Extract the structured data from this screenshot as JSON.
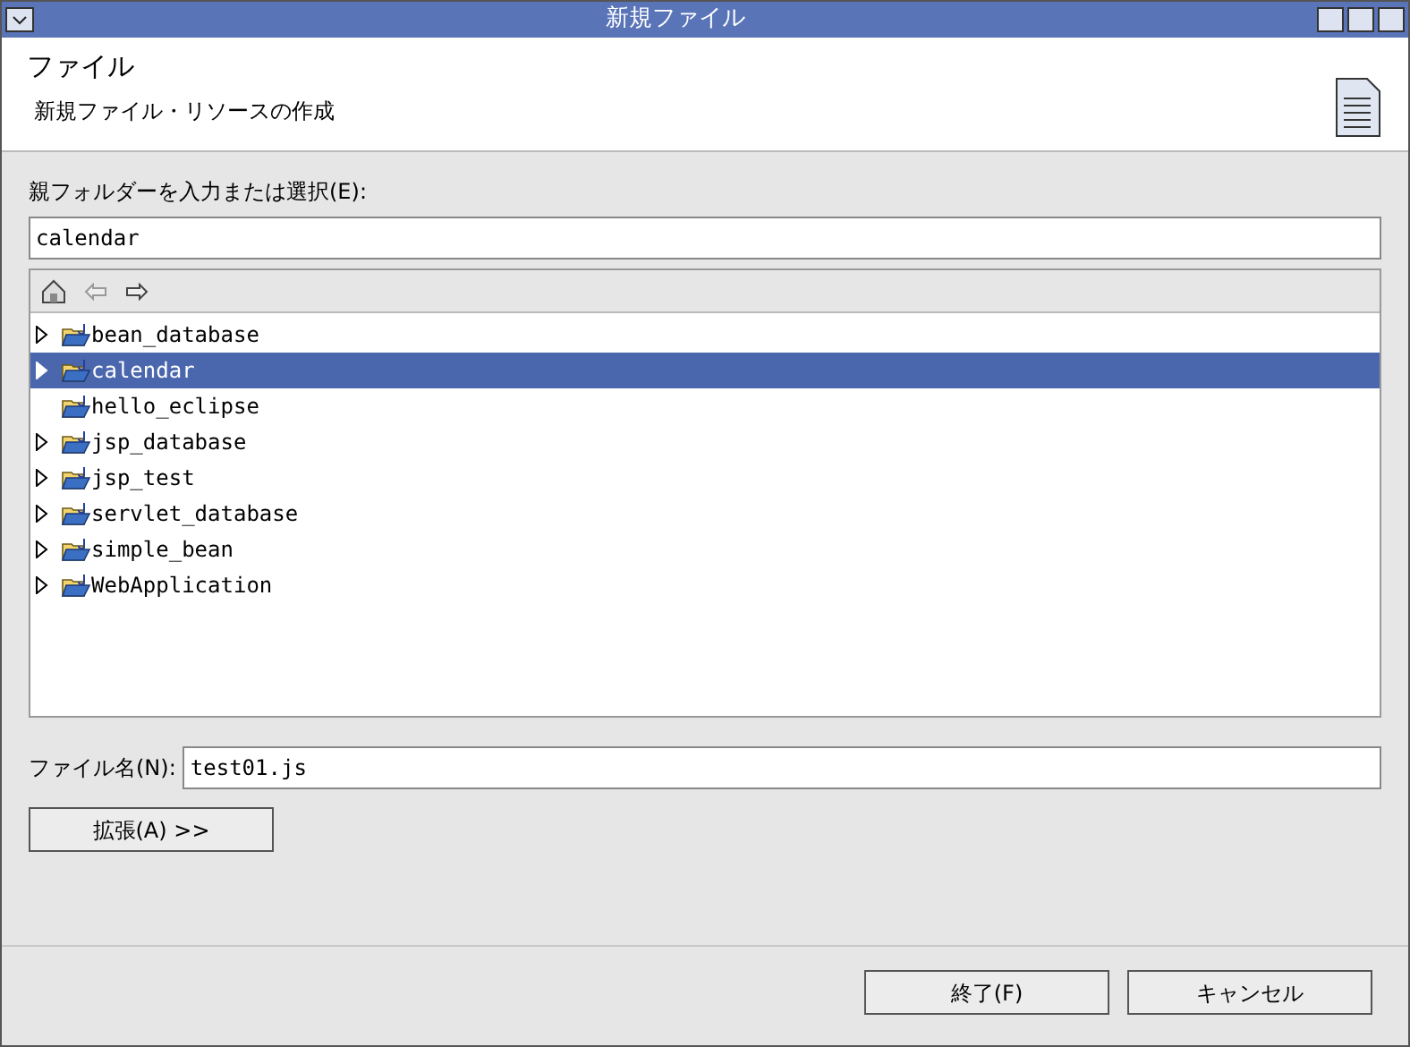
{
  "window": {
    "title": "新規ファイル"
  },
  "header": {
    "title": "ファイル",
    "description": "新規ファイル・リソースの作成"
  },
  "parent_folder": {
    "label": "親フォルダーを入力または選択(E):",
    "value": "calendar"
  },
  "tree": {
    "items": [
      {
        "label": "bean_database",
        "expandable": true,
        "selected": false
      },
      {
        "label": "calendar",
        "expandable": true,
        "selected": true
      },
      {
        "label": "hello_eclipse",
        "expandable": false,
        "selected": false
      },
      {
        "label": "jsp_database",
        "expandable": true,
        "selected": false
      },
      {
        "label": "jsp_test",
        "expandable": true,
        "selected": false
      },
      {
        "label": "servlet_database",
        "expandable": true,
        "selected": false
      },
      {
        "label": "simple_bean",
        "expandable": true,
        "selected": false
      },
      {
        "label": "WebApplication",
        "expandable": true,
        "selected": false
      }
    ]
  },
  "file_name": {
    "label": "ファイル名(N):",
    "value": "test01.js"
  },
  "advanced_button": "拡張(A) >>",
  "buttons": [
    "終了(F)",
    "キャンセル"
  ]
}
